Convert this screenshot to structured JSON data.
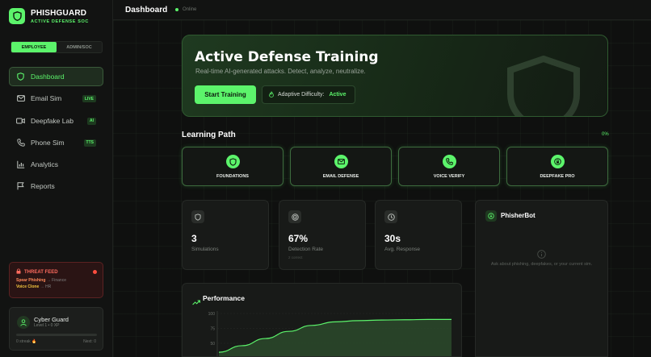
{
  "brand": {
    "name": "PHISHGUARD",
    "subtitle": "ACTIVE DEFENSE SOC"
  },
  "roles": {
    "employee": "EMPLOYEE",
    "admin": "ADMIN/SOC",
    "selected": "EMPLOYEE"
  },
  "nav": {
    "dashboard": "Dashboard",
    "email": "Email Sim",
    "email_badge": "LIVE",
    "deepfake": "Deepfake Lab",
    "deepfake_badge": "AI",
    "phone": "Phone Sim",
    "phone_badge": "TTS",
    "analytics": "Analytics",
    "reports": "Reports",
    "active": "Dashboard"
  },
  "threat_feed": {
    "title": "THREAT FEED",
    "items": [
      {
        "name": "Spear Phishing",
        "target": "→ Finance"
      },
      {
        "name": "Voice Clone",
        "target": "→ HR"
      }
    ]
  },
  "user": {
    "name": "Cyber Guard",
    "level": "Level 1 • 0 XP",
    "xp_progress": 0,
    "streak": "0 streak 🔥",
    "next": "Next: 0"
  },
  "topbar": {
    "title": "Dashboard",
    "status": "Online"
  },
  "hero": {
    "title": "Active Defense Training",
    "subtitle": "Real-time AI-generated attacks. Detect, analyze, neutralize.",
    "start_button": "Start Training",
    "adaptive_label": "Adaptive Difficulty:",
    "adaptive_value": "Active"
  },
  "learning_path": {
    "title": "Learning Path",
    "progress": "0%",
    "steps": [
      {
        "label": "FOUNDATIONS",
        "icon": "shield-icon"
      },
      {
        "label": "EMAIL DEFENSE",
        "icon": "mail-icon"
      },
      {
        "label": "VOICE VERIFY",
        "icon": "phone-icon"
      },
      {
        "label": "DEEPFAKE PRO",
        "icon": "lock-icon"
      }
    ]
  },
  "stats": {
    "simulations": {
      "value": "3",
      "label": "Simulations"
    },
    "detection": {
      "value": "67%",
      "label": "Detection Rate",
      "extra": "2 correct"
    },
    "response": {
      "value": "30s",
      "label": "Avg. Response"
    }
  },
  "phisherbot": {
    "title": "PhisherBot",
    "hint": "Ask about phishing, deepfakes, or your current sim."
  },
  "performance": {
    "title": "Performance"
  },
  "chart_data": {
    "type": "area",
    "title": "Performance",
    "yticks": [
      "100",
      "75",
      "50"
    ],
    "ylim": [
      0,
      100
    ],
    "x": [
      0,
      1,
      2,
      3,
      4,
      5,
      6,
      7,
      8,
      9,
      10
    ],
    "values": [
      35,
      46,
      58,
      70,
      80,
      86,
      88,
      89,
      89.5,
      90,
      90
    ],
    "grid": true,
    "colors": {
      "line": "#5cf46b",
      "fill": "#2b4a2c"
    }
  },
  "colors": {
    "accent": "#5cf46b",
    "danger": "#ff4d3f",
    "warning": "#f4c53d"
  }
}
